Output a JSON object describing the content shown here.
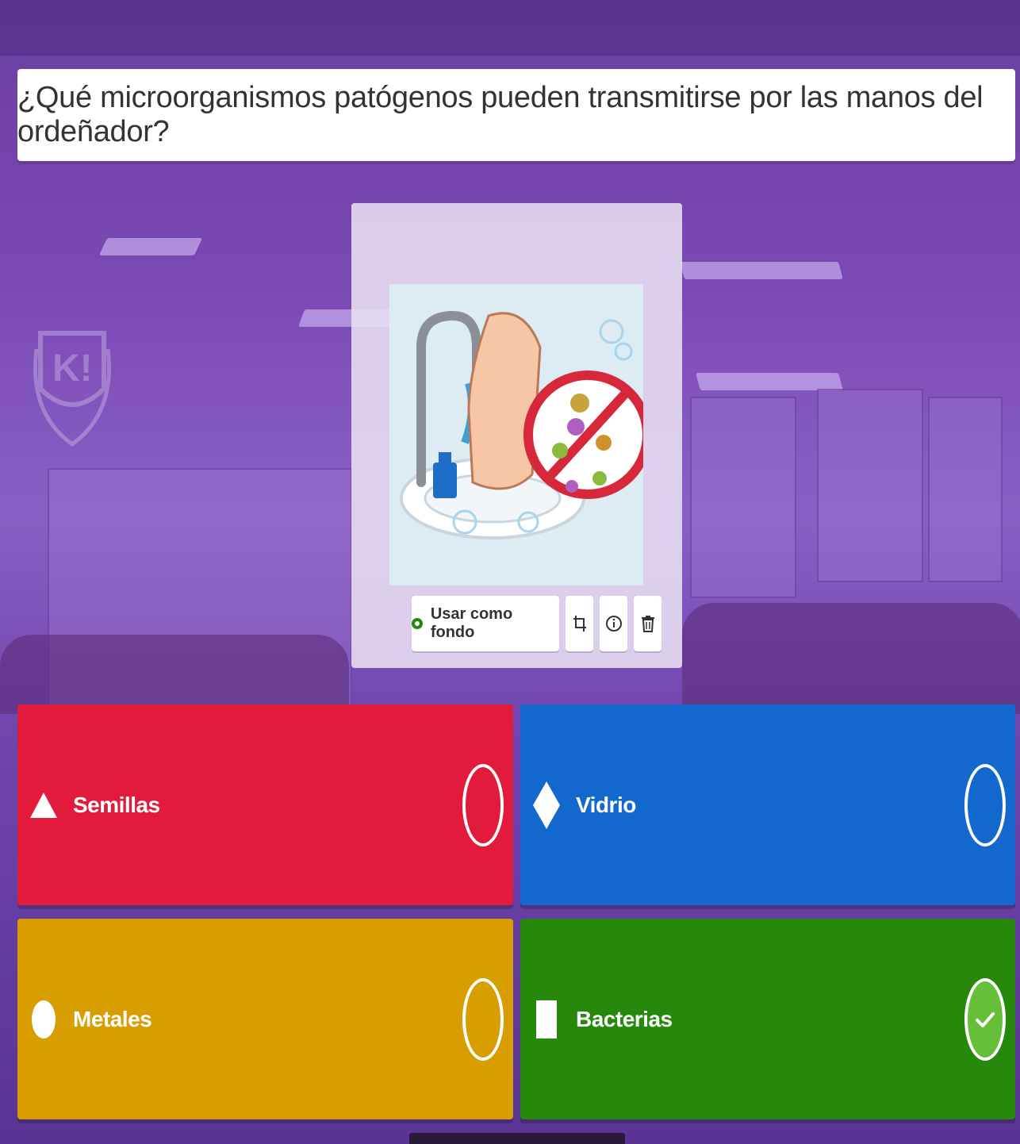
{
  "question": {
    "text": "¿Qué microorganismos patógenos pueden transmitirse por las manos del ordeñador?"
  },
  "media": {
    "image_icon": "handwashing-illustration",
    "use_as_background_label": "Usar como fondo",
    "tool_icons": [
      "crop-icon",
      "info-icon",
      "trash-icon"
    ]
  },
  "answers": [
    {
      "shape": "triangle",
      "label": "Semillas",
      "color": "#e21b3c",
      "correct": false
    },
    {
      "shape": "diamond",
      "label": "Vidrio",
      "color": "#1368ce",
      "correct": false
    },
    {
      "shape": "circle",
      "label": "Metales",
      "color": "#d89e00",
      "correct": false
    },
    {
      "shape": "square",
      "label": "Bacterias",
      "color": "#26890c",
      "correct": true
    }
  ]
}
